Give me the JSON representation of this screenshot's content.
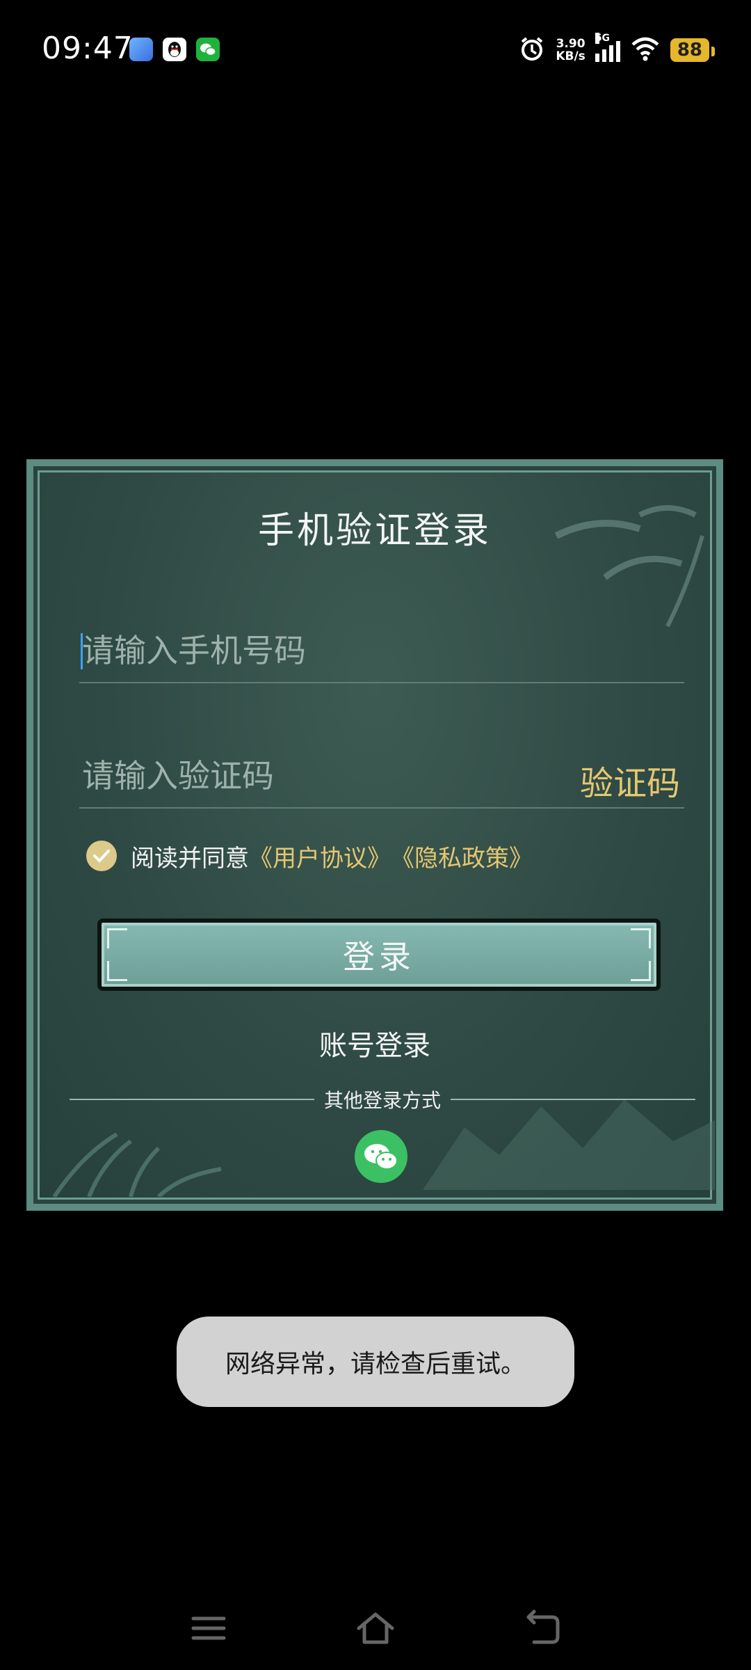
{
  "status_bar": {
    "time": "09:47",
    "net_speed_value": "3.90",
    "net_speed_unit": "KB/s",
    "signal_label": "5G",
    "battery": "88",
    "icons": [
      "app-icon",
      "qq-icon",
      "wechat-icon",
      "alarm-icon",
      "signal-icon",
      "wifi-icon",
      "battery-icon"
    ]
  },
  "dialog": {
    "title": "手机验证登录",
    "phone_placeholder": "请输入手机号码",
    "code_placeholder": "请输入验证码",
    "get_code_label": "验证码",
    "agree_text": "阅读并同意",
    "user_agreement": "《用户协议》",
    "privacy_policy": "《隐私政策》",
    "agreement_checked": true,
    "login_button": "登录",
    "account_login": "账号登录",
    "other_methods": "其他登录方式"
  },
  "toast": {
    "message": "网络异常，请检查后重试。"
  },
  "colors": {
    "accent_gold": "#e5c772",
    "dialog_bg": "#2f4a44",
    "login_button": "#7aaba3",
    "wechat_green": "#3cc064"
  }
}
